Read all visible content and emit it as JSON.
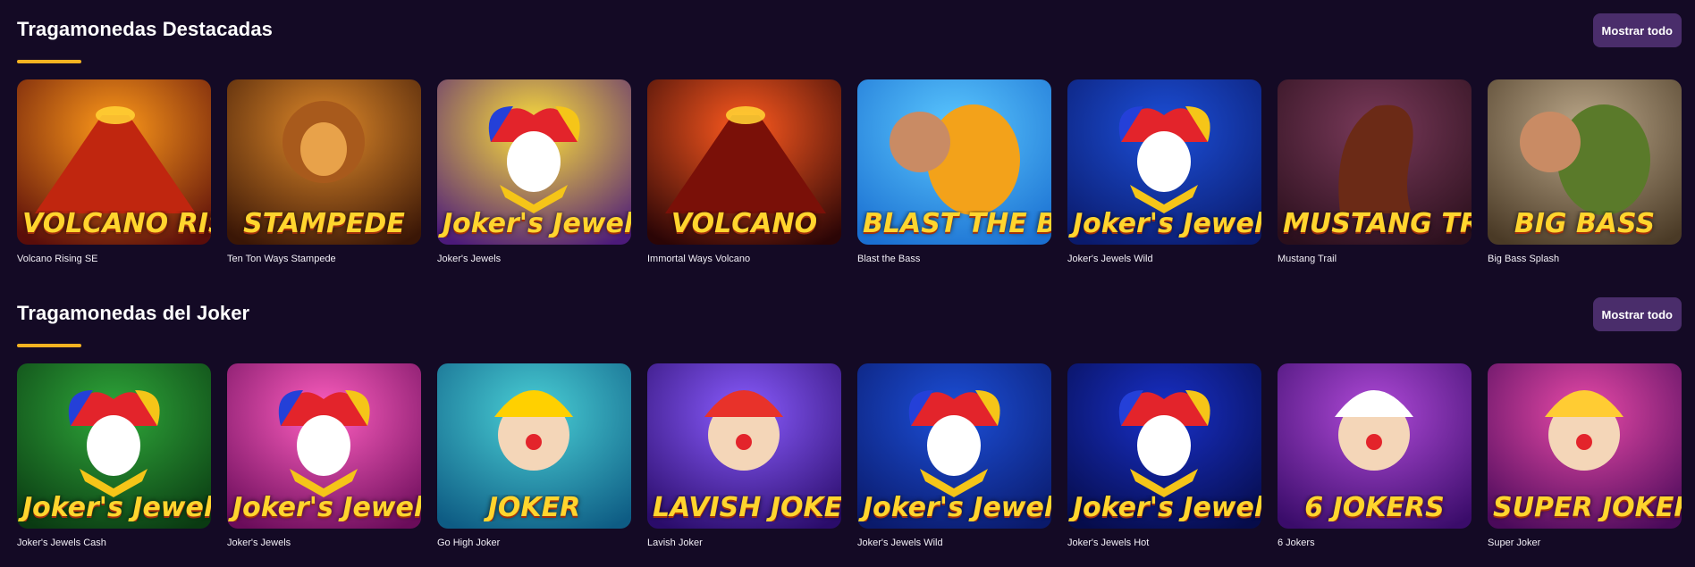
{
  "sections": [
    {
      "title": "Tragamonedas Destacadas",
      "show_all_label": "Mostrar todo",
      "games": [
        {
          "name": "Volcano Rising SE",
          "logo": "VOLCANO RISING",
          "theme": "volcano"
        },
        {
          "name": "Ten Ton Ways Stampede",
          "logo": "STAMPEDE",
          "theme": "savanna"
        },
        {
          "name": "Joker's Jewels",
          "logo": "Joker's Jewels",
          "theme": "joker-yellow"
        },
        {
          "name": "Immortal Ways Volcano",
          "logo": "VOLCANO",
          "theme": "immortal"
        },
        {
          "name": "Blast the Bass",
          "logo": "BLAST THE BASS",
          "theme": "bass"
        },
        {
          "name": "Joker's Jewels Wild",
          "logo": "Joker's Jewels WILD",
          "theme": "joker-blue"
        },
        {
          "name": "Mustang Trail",
          "logo": "MUSTANG TRAIL",
          "theme": "mustang"
        },
        {
          "name": "Big Bass Splash",
          "logo": "BIG BASS",
          "theme": "bigbass"
        }
      ]
    },
    {
      "title": "Tragamonedas del Joker",
      "show_all_label": "Mostrar todo",
      "games": [
        {
          "name": "Joker's Jewels Cash",
          "logo": "Joker's Jewels CASH",
          "theme": "joker-green"
        },
        {
          "name": "Joker's Jewels",
          "logo": "Joker's Jewels",
          "theme": "joker-pink"
        },
        {
          "name": "Go High Joker",
          "logo": "JOKER",
          "theme": "gohigh"
        },
        {
          "name": "Lavish Joker",
          "logo": "LAVISH JOKER",
          "theme": "lavish"
        },
        {
          "name": "Joker's Jewels Wild",
          "logo": "Joker's Jewels WILD",
          "theme": "joker-blue"
        },
        {
          "name": "Joker's Jewels Hot",
          "logo": "Joker's Jewels HOT",
          "theme": "joker-hot"
        },
        {
          "name": "6 Jokers",
          "logo": "6 JOKERS",
          "theme": "sixjokers"
        },
        {
          "name": "Super Joker",
          "logo": "SUPER JOKER",
          "theme": "superjoker"
        }
      ]
    }
  ],
  "colors": {
    "background": "#140a25",
    "accent_underline": "#f6b321",
    "button_bg": "#4a2d6b"
  }
}
